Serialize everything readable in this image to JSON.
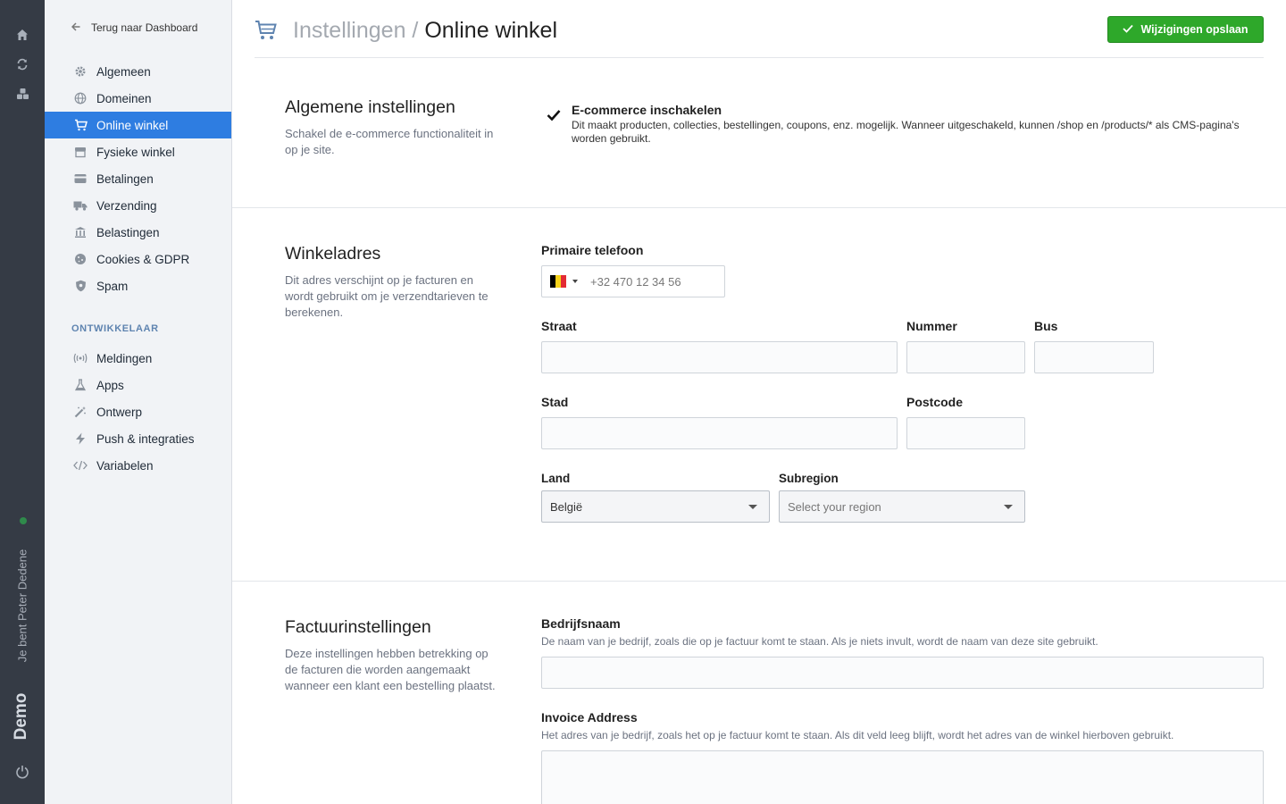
{
  "rail": {
    "user_text": "Je bent Peter Dedene",
    "site_text": "Demo"
  },
  "sidebar": {
    "back_label": "Terug naar Dashboard",
    "items": [
      {
        "label": "Algemeen",
        "icon": "gear-icon"
      },
      {
        "label": "Domeinen",
        "icon": "globe-icon"
      },
      {
        "label": "Online winkel",
        "icon": "cart-icon",
        "active": true
      },
      {
        "label": "Fysieke winkel",
        "icon": "store-icon"
      },
      {
        "label": "Betalingen",
        "icon": "credit-card-icon"
      },
      {
        "label": "Verzending",
        "icon": "truck-icon"
      },
      {
        "label": "Belastingen",
        "icon": "bank-icon"
      },
      {
        "label": "Cookies & GDPR",
        "icon": "cookie-icon"
      },
      {
        "label": "Spam",
        "icon": "shield-icon"
      }
    ],
    "developer_label": "ONTWIKKELAAR",
    "dev_items": [
      {
        "label": "Meldingen",
        "icon": "broadcast-icon"
      },
      {
        "label": "Apps",
        "icon": "flask-icon"
      },
      {
        "label": "Ontwerp",
        "icon": "magic-wand-icon"
      },
      {
        "label": "Push & integraties",
        "icon": "bolt-icon"
      },
      {
        "label": "Variabelen",
        "icon": "code-icon"
      }
    ]
  },
  "header": {
    "breadcrumb_parent": "Instellingen /",
    "title": "Online winkel",
    "save_label": "Wijzigingen opslaan"
  },
  "general": {
    "title": "Algemene instellingen",
    "description": "Schakel de e-commerce functionaliteit in op je site.",
    "toggle_label": "E-commerce inschakelen",
    "toggle_checked": true,
    "toggle_description": "Dit maakt producten, collecties, bestellingen, coupons, enz. mogelijk. Wanneer uitgeschakeld, kunnen /shop en /products/* als CMS-pagina's worden gebruikt."
  },
  "address": {
    "title": "Winkeladres",
    "description": "Dit adres verschijnt op je facturen en wordt gebruikt om je verzendtarieven te berekenen.",
    "phone_label": "Primaire telefoon",
    "phone_placeholder": "+32 470 12 34 56",
    "street_label": "Straat",
    "number_label": "Nummer",
    "bus_label": "Bus",
    "city_label": "Stad",
    "postcode_label": "Postcode",
    "country_label": "Land",
    "country_value": "België",
    "subregion_label": "Subregion",
    "subregion_placeholder": "Select your region"
  },
  "invoice": {
    "title": "Factuurinstellingen",
    "description": "Deze instellingen hebben betrekking op de facturen die worden aangemaakt wanneer een klant een bestelling plaatst.",
    "company_label": "Bedrijfsnaam",
    "company_hint": "De naam van je bedrijf, zoals die op je factuur komt te staan. Als je niets invult, wordt de naam van deze site gebruikt.",
    "address_label": "Invoice Address",
    "address_hint": "Het adres van je bedrijf, zoals het op je factuur komt te staan. Als dit veld leeg blijft, wordt het adres van de winkel hierboven gebruikt."
  },
  "colors": {
    "accent": "#2e7de1",
    "save": "#2ea82a",
    "rail": "#353b45",
    "online_dot": "#2f8a4b"
  }
}
